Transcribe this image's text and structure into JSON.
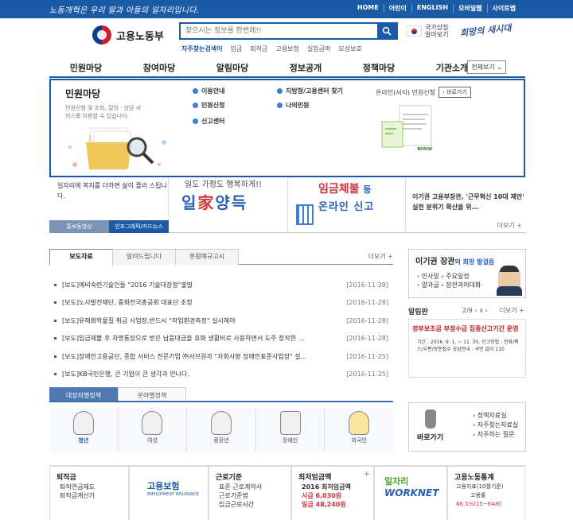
{
  "topbar": {
    "slogan": "노동개혁은 우리 딸과 아들의 일자리입니다.",
    "links": [
      "HOME",
      "어린이",
      "ENGLISH",
      "모바일웹",
      "사이트맵"
    ]
  },
  "header": {
    "logo_text": "고용노동부",
    "search_placeholder": "찾으시는 정보를 한번에!!",
    "keywords_title": "자주찾는검색어",
    "keywords": [
      "임금",
      "퇴직금",
      "고용보험",
      "실업급여",
      "모성보호"
    ],
    "flag_text": "국가상징 알아보기",
    "calligraphy": "희망의 새시대"
  },
  "gnb": {
    "menus": [
      "민원마당",
      "참여마당",
      "알림마당",
      "정보공개",
      "정책마당",
      "기관소개"
    ],
    "all_button": "전체보기"
  },
  "mega": {
    "title": "민원마당",
    "desc": "민원신청 및 조회, 질의 · 상담 서비스를 이용할 수 있습니다.",
    "items": [
      "이용안내",
      "민원신청",
      "신고센터",
      "지방청/고용센터 찾기",
      "나의민원"
    ],
    "online_label": "온라인(서식) 민원신청",
    "online_button": "바로가기",
    "www_text": "www"
  },
  "banner": {
    "left_text": "일자리에 복지를 더하면 삶이 플러 스됩니다.",
    "left_tabs": [
      "홍보동영상",
      "인포그래픽/카드뉴스"
    ],
    "mid1_small": "일도 가정도 행복하게!!",
    "mid1_big_parts": [
      "일",
      "家",
      "양",
      "득"
    ],
    "mid2_line1": "임금체불",
    "mid2_line1_suffix": "등",
    "mid2_line2": "온라인 신고",
    "right_text": "이기권 고용부장관, '근무혁신 10대 제안' 실천 분위기 확산을 위...",
    "right_more": "더보기 +"
  },
  "news": {
    "tabs": [
      "보도자료",
      "알려드립니다",
      "훈령예규고시"
    ],
    "more": "더보기 +",
    "items": [
      {
        "title": "[보도]예비숙련기술인들 \"2016 기술대장정\"출발",
        "date": "[2016-11-28]"
      },
      {
        "title": "[보도]노사발전재단, 중화전국총공회 대표단 초청",
        "date": "[2016-11-28]"
      },
      {
        "title": "[보도]유해화학물질 취급 사업장,반드시 \"작업환경측정\" 실시해야",
        "date": "[2016-11-28]"
      },
      {
        "title": "[보도]임금체불 후 차명통장으로 받은 납품대금을 호화 생활비로 사용하면서 도주 장작한 ...",
        "date": "[2016-11-28]"
      },
      {
        "title": "[보도]장애인고용공단, 종합 서비스 전문기업 ㈜서브원과 \"자회사형 장애인표준사업장\" 설...",
        "date": "[2016-11-25]"
      },
      {
        "title": "[보도]KB국민은행, 큰 기업이 큰 생각과 만나다.",
        "date": "[2016-11-25]"
      }
    ]
  },
  "minister": {
    "title": "이기권 장관",
    "subtitle": "의 희망 발걸음",
    "links": [
      "인사말",
      "주요일정",
      "말과글",
      "장관과의대화"
    ]
  },
  "alrim": {
    "title": "알림판",
    "pager": "2/9",
    "more": "더보기 +",
    "card_title": "정부보조금 부정수급 집중신고기간 운영",
    "card_body": "기간 : 2016. 9. 1. ~ 11. 30. 신고방법 : 전화/팩스/우편/방문접수 상담안내 : 국번 없이 110"
  },
  "target": {
    "tabs": [
      "대상자별정책",
      "분야별정책"
    ],
    "persons": [
      "청년",
      "여성",
      "중장년",
      "장애인",
      "외국인"
    ]
  },
  "baro": {
    "label": "바로가기",
    "links": [
      "정책자료실",
      "자주찾는자료실",
      "자주하는 질문"
    ]
  },
  "bottom": {
    "boxes": [
      {
        "title": "퇴직금",
        "lines": [
          "퇴직연금제도",
          "퇴직금계산기"
        ]
      },
      {
        "title": "고용보험",
        "lines": [
          "EMPLOYMENT INSURANCE"
        ]
      },
      {
        "title": "근로기준",
        "lines": [
          "표준 근로계약서",
          "근로기준법",
          "임금근로시간"
        ]
      },
      {
        "title": "최저임금액",
        "lines": [
          "2016 최저임금액",
          "시급 6,030원",
          "일급 48,240원"
        ]
      },
      {
        "title": "일자리",
        "lines": [
          "WORKNET"
        ]
      },
      {
        "title": "고용노동통계",
        "lines": [
          "고용지표(10월기준)",
          "고용률",
          "66.5%(15~64세)"
        ]
      }
    ]
  },
  "colors": {
    "primary": "#1b5aa6",
    "accent_red": "#d0333a"
  }
}
